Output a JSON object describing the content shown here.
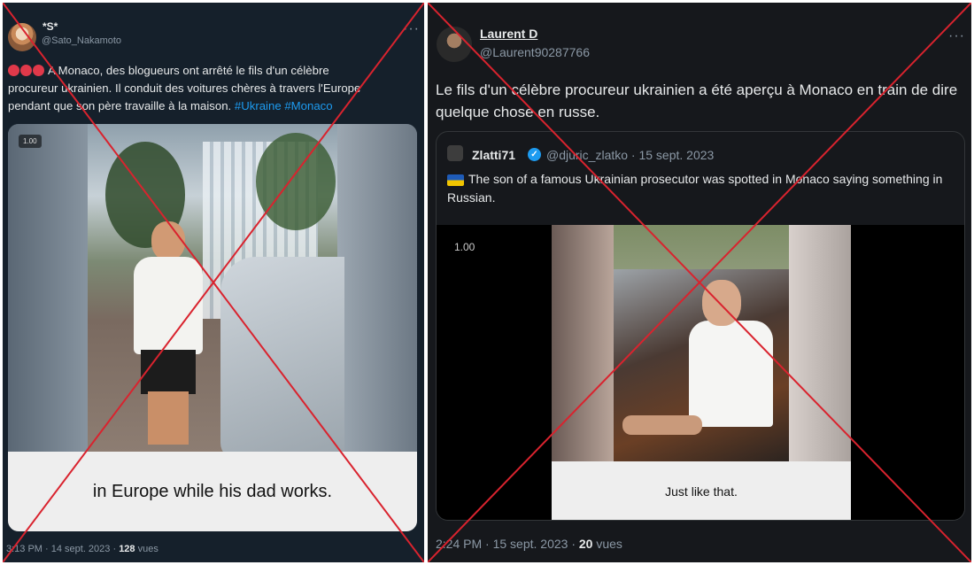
{
  "left_tweet": {
    "display_name": "*S*",
    "handle": "@Sato_Nakamoto",
    "text_main": "A Monaco, des blogueurs ont arrêté le fils d'un célèbre procureur ukrainien. Il conduit des voitures chères à travers l'Europe pendant que son père travaille à la maison.",
    "hashtag_1": "#Ukraine",
    "hashtag_2": "#Monaco",
    "video_speed": "1.00",
    "video_caption": "in Europe while his dad works.",
    "timestamp": "3:13 PM · 14 sept. 2023 · ",
    "views_count": "128",
    "views_label": " vues"
  },
  "right_tweet": {
    "display_name": "Laurent D",
    "handle": "@Laurent90287766",
    "text": "Le fils d'un célèbre procureur ukrainien a été aperçu à Monaco en train de dire quelque chose en russe.",
    "quoted": {
      "display_name": "Zlatti71",
      "handle_date": "@djuric_zlatko · 15 sept. 2023",
      "text": "The son of a famous Ukrainian prosecutor was spotted in Monaco saying something in Russian.",
      "video_speed": "1.00",
      "video_caption": "Just like that."
    },
    "timestamp": "2:24 PM · 15 sept. 2023 · ",
    "views_count": "20",
    "views_label": " vues"
  },
  "more_symbol": "···",
  "verified_symbol": "✓",
  "colors": {
    "cross": "#d9232e",
    "link": "#1d9bf0",
    "panel_left_bg": "#15202b",
    "panel_right_bg": "#16181c"
  }
}
